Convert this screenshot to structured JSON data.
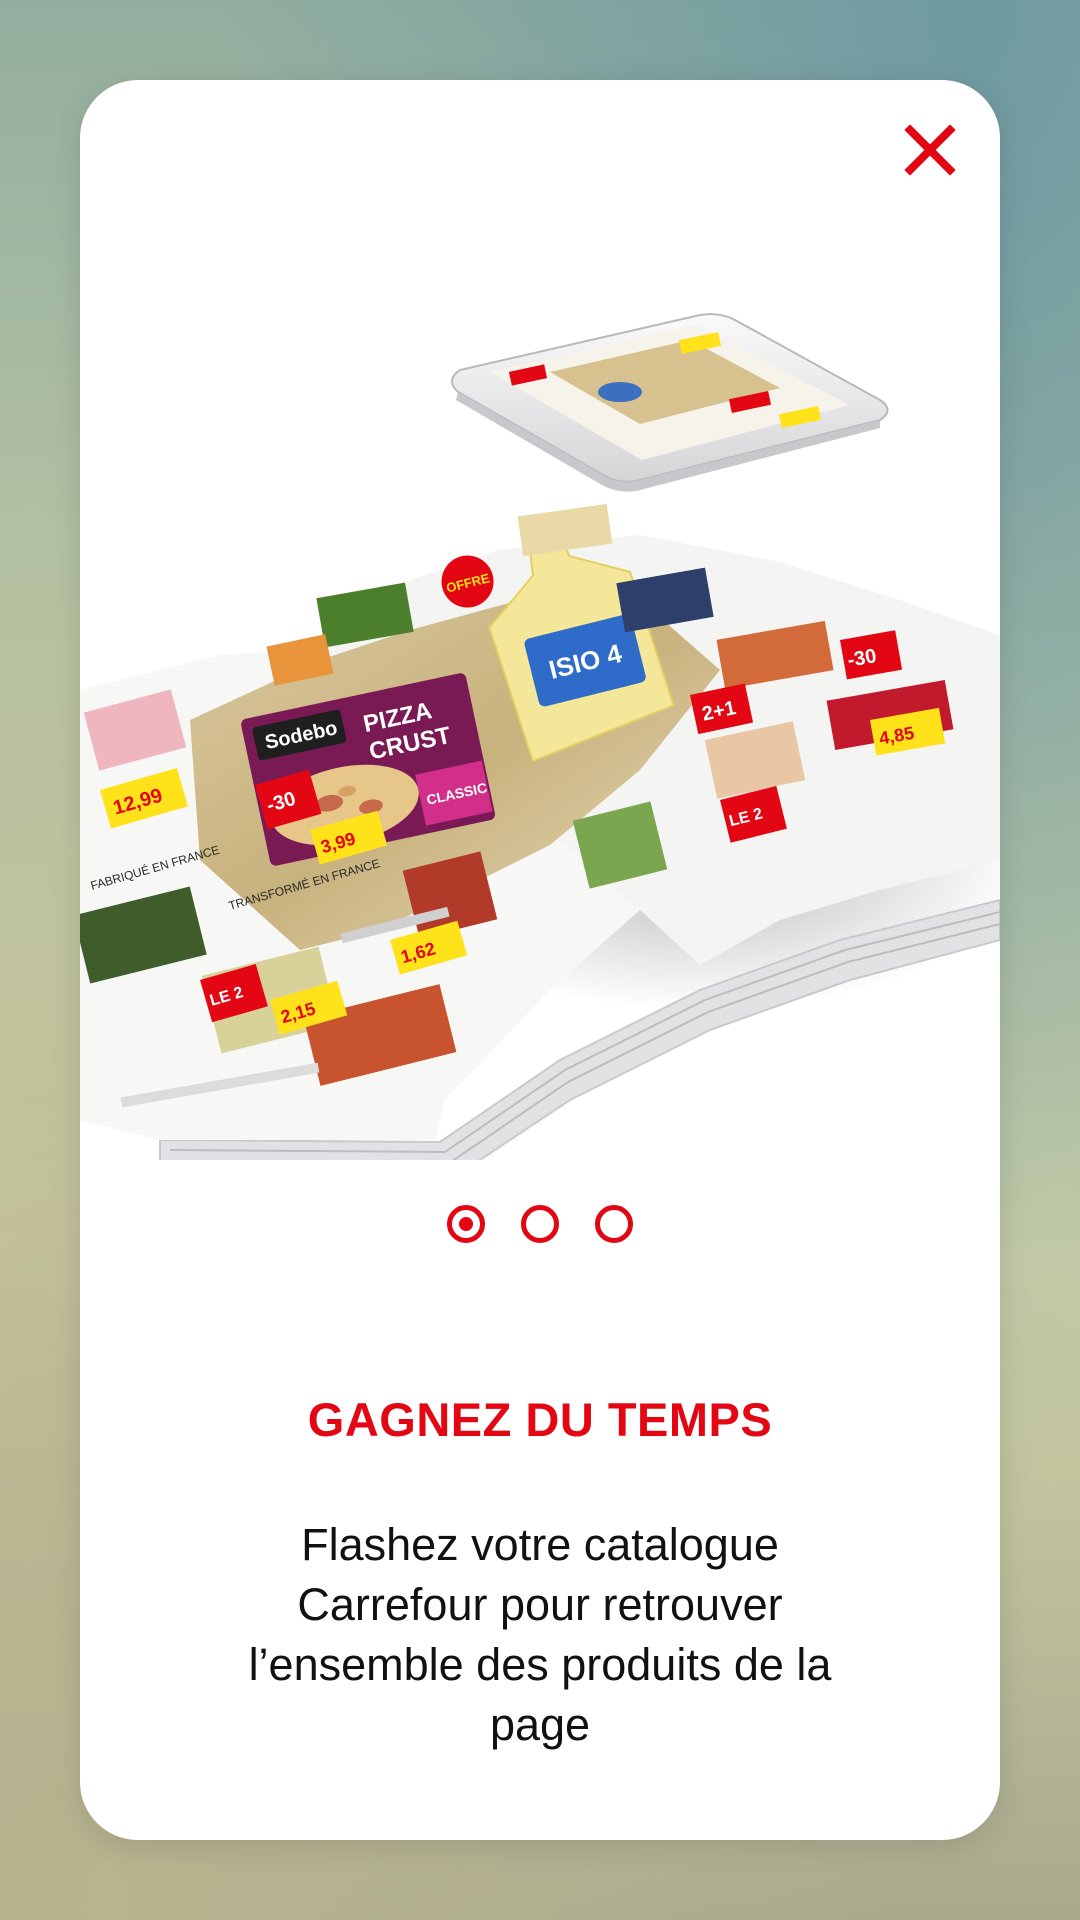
{
  "colors": {
    "accent": "#e30613",
    "text": "#111111",
    "card": "#ffffff"
  },
  "close_button": {
    "icon": "close-icon"
  },
  "illustration": {
    "icon": "catalogue-phone-illustration",
    "book_labels": {
      "brand": "Sodebo",
      "pizza_line1": "PIZZA",
      "pizza_line2": "CRUST",
      "classic": "CLASSIC",
      "promo_left": "-30",
      "promo_left_2": "LE 2",
      "offer": "OFFRE",
      "oil_brand": "ISIO 4",
      "promo_pair": "2+1",
      "promo_right": "-30",
      "promo_right_2": "LE 2",
      "price_1": "12,99",
      "price_2": "3,99",
      "price_3": "2,15",
      "price_4": "1,62",
      "price_5": "4,85",
      "france_1": "FABRIQUÉ EN FRANCE",
      "france_2": "TRANSFORMÉ EN FRANCE"
    }
  },
  "pager": {
    "pages": [
      {
        "label": "page-1",
        "active": true
      },
      {
        "label": "page-2",
        "active": false
      },
      {
        "label": "page-3",
        "active": false
      }
    ]
  },
  "slide": {
    "title": "GAGNEZ DU TEMPS",
    "description": "Flashez votre catalogue Carrefour pour retrouver l’ensemble des produits de la page"
  }
}
